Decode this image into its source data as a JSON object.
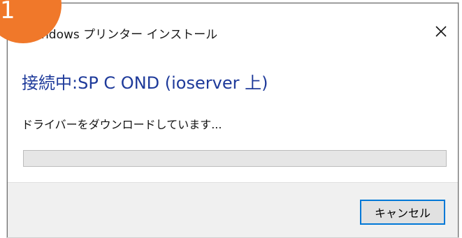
{
  "window": {
    "title": "ndows プリンター インストール",
    "close_icon": "close-icon"
  },
  "content": {
    "heading": "接続中:SP C OND (ioserver 上)",
    "status": "ドライバーをダウンロードしています..."
  },
  "progress": {
    "value_percent": 0,
    "fill_color": "#06b025"
  },
  "footer": {
    "cancel_label": "キャンセル"
  },
  "badge": {
    "label": "1",
    "color": "#f0782a"
  },
  "colors": {
    "heading": "#1e3a9a",
    "button_border": "#0078d7"
  }
}
